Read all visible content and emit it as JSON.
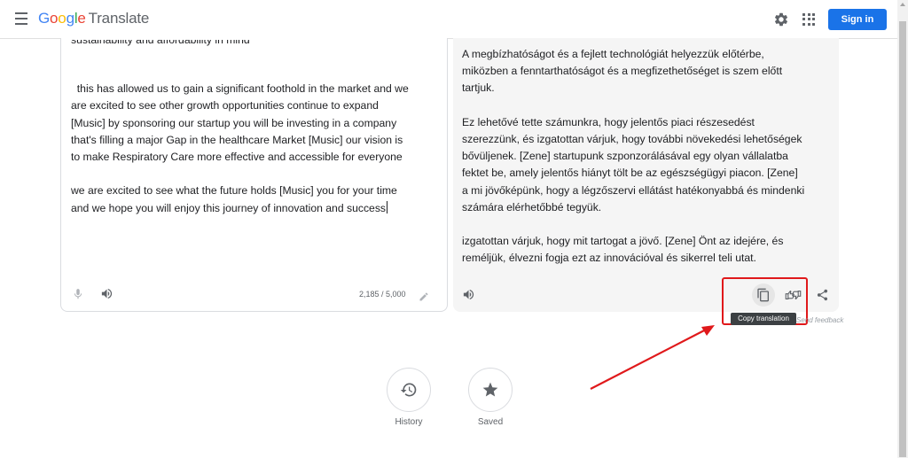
{
  "header": {
    "logo_google": "Google",
    "logo_translate": "Translate",
    "signin_label": "Sign in"
  },
  "source": {
    "text_partial_top": "sustainability and affordability in mind",
    "text": "this has allowed us to gain a significant foothold in the market and we\nare excited to see other growth opportunities continue to expand\n[Music] by sponsoring our startup you will be investing in a company\nthat's filling a major Gap in the healthcare Market [Music] our vision is\nto make Respiratory Care more effective and accessible for everyone\n\nwe are excited to see what the future holds [Music] you for your time\nand we hope you will enjoy this journey of innovation and success",
    "char_count": "2,185 / 5,000"
  },
  "target": {
    "text": "A megbízhatóságot és a fejlett technológiát helyezzük előtérbe,\nmiközben a fenntarthatóságot és a megfizethetőséget is szem előtt\ntartjuk.\n\nEz lehetővé tette számunkra, hogy jelentős piaci részesedést\nszerezzünk, és izgatottan várjuk, hogy további növekedési lehetőségek\nbővüljenek. [Zene] startupunk szponzorálásával egy olyan vállalatba\nfektet be, amely jelentős hiányt tölt be az egészségügyi piacon. [Zene]\na mi jövőképünk, hogy a légzőszervi ellátást hatékonyabbá és mindenki\nszámára elérhetőbbé tegyük.\n\nizgatottan várjuk, hogy mit tartogat a jövő. [Zene] Önt az idejére, és\nreméljük, élvezni fogja ezt az innovációval és sikerrel teli utat.",
    "tooltip": "Copy translation",
    "send_feedback": "Send feedback"
  },
  "bottom": {
    "history_label": "History",
    "saved_label": "Saved"
  },
  "colors": {
    "accent": "#1a73e8",
    "annotation_red": "#e0191b",
    "google_blue": "#4285f4",
    "google_red": "#ea4335",
    "google_yellow": "#fbbc05",
    "google_green": "#34a853"
  },
  "icons": [
    "menu-icon",
    "gear-icon",
    "apps-grid-icon",
    "microphone-icon",
    "speaker-icon",
    "pencil-icon",
    "copy-icon",
    "rate-translation-icon",
    "share-icon",
    "history-icon",
    "star-icon"
  ]
}
